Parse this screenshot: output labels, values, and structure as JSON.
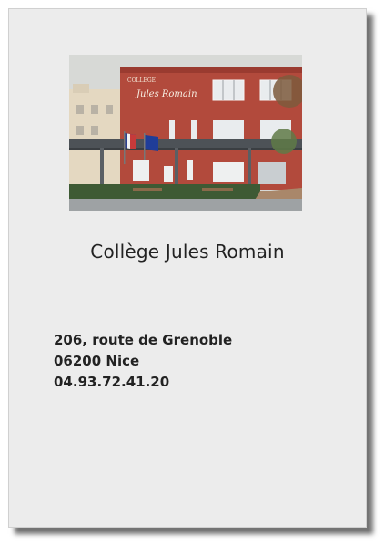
{
  "card": {
    "image": {
      "subject": "school-building-photo",
      "sign_top": "COLLÈGE",
      "sign_name": "Jules Romain"
    },
    "title": "Collège Jules Romain",
    "address": {
      "street": "206, route de Grenoble",
      "city": "06200 Nice",
      "phone": "04.93.72.41.20"
    }
  },
  "colors": {
    "card_background": "#ececec",
    "text": "#222222",
    "building_facade": "#b24a3c"
  }
}
